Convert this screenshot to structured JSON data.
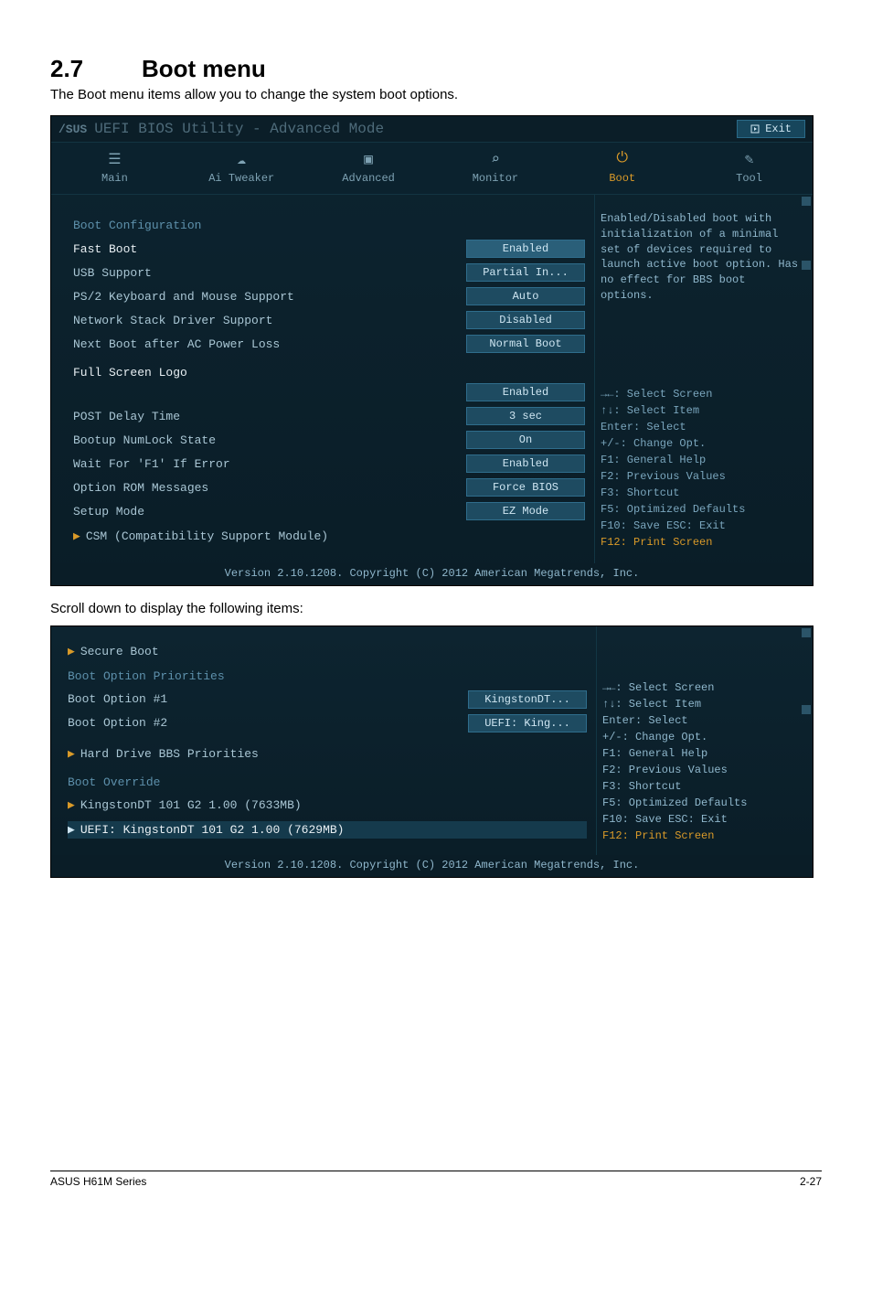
{
  "page": {
    "section_num": "2.7",
    "section_title": "Boot menu",
    "section_desc": "The Boot menu items allow you to change the system boot options.",
    "intertext": "Scroll down to display the following items:",
    "footer_left": "ASUS H61M Series",
    "footer_right": "2-27"
  },
  "bios1": {
    "top_logo": "/SUS",
    "top_title": "UEFI BIOS Utility - Advanced Mode",
    "exit_label": "Exit",
    "tabs": {
      "main": "Main",
      "tweaker": "Ai Tweaker",
      "advanced": "Advanced",
      "monitor": "Monitor",
      "boot": "Boot",
      "tool": "Tool"
    },
    "groups": {
      "boot_config": "Boot Configuration",
      "full_logo": "Full Screen Logo"
    },
    "rows": {
      "fast_boot": {
        "label": "Fast Boot",
        "value": "Enabled"
      },
      "usb_support": {
        "label": "USB Support",
        "value": "Partial In..."
      },
      "ps2_support": {
        "label": "PS/2 Keyboard and Mouse Support",
        "value": "Auto"
      },
      "net_stack": {
        "label": "Network Stack Driver Support",
        "value": "Disabled"
      },
      "next_boot": {
        "label": "Next Boot after AC Power Loss",
        "value": "Normal Boot"
      },
      "full_logo_val": {
        "label": "Full Screen Logo",
        "value": "Enabled"
      },
      "post_delay": {
        "label": "POST Delay Time",
        "value": "3 sec"
      },
      "numlock": {
        "label": "Bootup NumLock State",
        "value": "On"
      },
      "wait_f1": {
        "label": "Wait For 'F1' If Error",
        "value": "Enabled"
      },
      "rom_msg": {
        "label": "Option ROM Messages",
        "value": "Force BIOS"
      },
      "setup_mode": {
        "label": "Setup Mode",
        "value": "EZ Mode"
      }
    },
    "submenu_csm": "CSM (Compatibility Support Module)",
    "help_desc": "Enabled/Disabled boot with initialization of a minimal set of devices required to launch active boot option. Has no effect for BBS boot options.",
    "keyhelp": {
      "l1": "→←: Select Screen",
      "l2": "↑↓: Select Item",
      "l3": "Enter: Select",
      "l4": "+/-: Change Opt.",
      "l5": "F1: General Help",
      "l6": "F2: Previous Values",
      "l7": "F3: Shortcut",
      "l8": "F5: Optimized Defaults",
      "l9": "F10: Save  ESC: Exit",
      "l10": "F12: Print Screen"
    },
    "footer": "Version 2.10.1208. Copyright (C) 2012 American Megatrends, Inc."
  },
  "bios2": {
    "secure_boot": "Secure Boot",
    "priorities_title": "Boot Option Priorities",
    "opt1": {
      "label": "Boot Option #1",
      "value": "KingstonDT..."
    },
    "opt2": {
      "label": "Boot Option #2",
      "value": "UEFI: King..."
    },
    "hdd_sub": "Hard Drive BBS Priorities",
    "override_title": "Boot Override",
    "override1": "KingstonDT 101 G2 1.00  (7633MB)",
    "override2": "UEFI: KingstonDT 101 G2 1.00 (7629MB)",
    "keyhelp": {
      "l1": "→←: Select Screen",
      "l2": "↑↓: Select Item",
      "l3": "Enter: Select",
      "l4": "+/-: Change Opt.",
      "l5": "F1: General Help",
      "l6": "F2: Previous Values",
      "l7": "F3: Shortcut",
      "l8": "F5: Optimized Defaults",
      "l9": "F10: Save  ESC: Exit",
      "l10": "F12: Print Screen"
    },
    "footer": "Version 2.10.1208. Copyright (C) 2012 American Megatrends, Inc."
  }
}
